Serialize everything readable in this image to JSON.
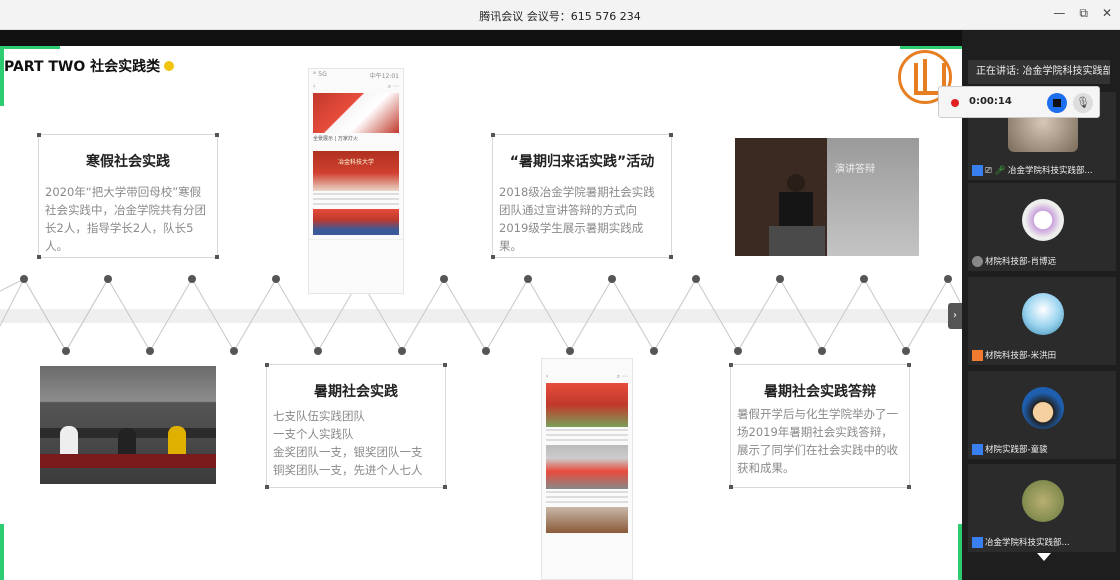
{
  "window": {
    "title": "腾讯会议  会议号：615 576 234",
    "min_icon": "—",
    "max_icon": "⧉",
    "close_icon": "✕"
  },
  "slide": {
    "heading": "PART TWO 社会实践类",
    "top_cards": [
      {
        "title": "寒假社会实践",
        "body": "2020年“把大学带回母校”寒假社会实践中，冶金学院共有分团长2人，指导学长2人，队长5人。"
      },
      {
        "title": "“暑期归来话实践”活动",
        "body": "2018级冶金学院暑期社会实践团队通过宣讲答辩的方式向2019级学生展示暑期实践成果。"
      }
    ],
    "bottom_cards": [
      {
        "title": "暑期社会实践",
        "body": "七支队伍实践团队\n一支个人实践队\n金奖团队一支，银奖团队一支\n铜奖团队一支，先进个人七人"
      },
      {
        "title": "暑期社会实践答辩",
        "body": "暑假开学后与化生学院举办了一场2019年暑期社会实践答辩，展示了同学们在社会实践中的收获和成果。"
      }
    ],
    "phone_top": {
      "status_left": "ᴵᴵᴵ 5G",
      "status_right": "中午12:01",
      "caption1": "全景展示 | 万家灯火",
      "caption2": "冶金科技大学"
    },
    "photo_stage_text": "演讲答辩",
    "next_arrow": "›"
  },
  "sidebar": {
    "speaking": "正在讲话: 冶金学院科技实践部...",
    "recording": {
      "time": "0:00:14"
    },
    "tiles": [
      {
        "name": "冶金学院科技实践部..."
      },
      {
        "name": "材院科技部-肖博远"
      },
      {
        "name": "材院科技部-米洪田"
      },
      {
        "name": "材院实践部-童骏"
      },
      {
        "name": "冶金学院科技实践部..."
      }
    ]
  },
  "colors": {
    "accent_green": "#2ecc71",
    "dot_yellow": "#f1c40f",
    "logo_orange": "#e67e22",
    "rec_red": "#e02020",
    "stop_blue": "#1e6ef0"
  }
}
